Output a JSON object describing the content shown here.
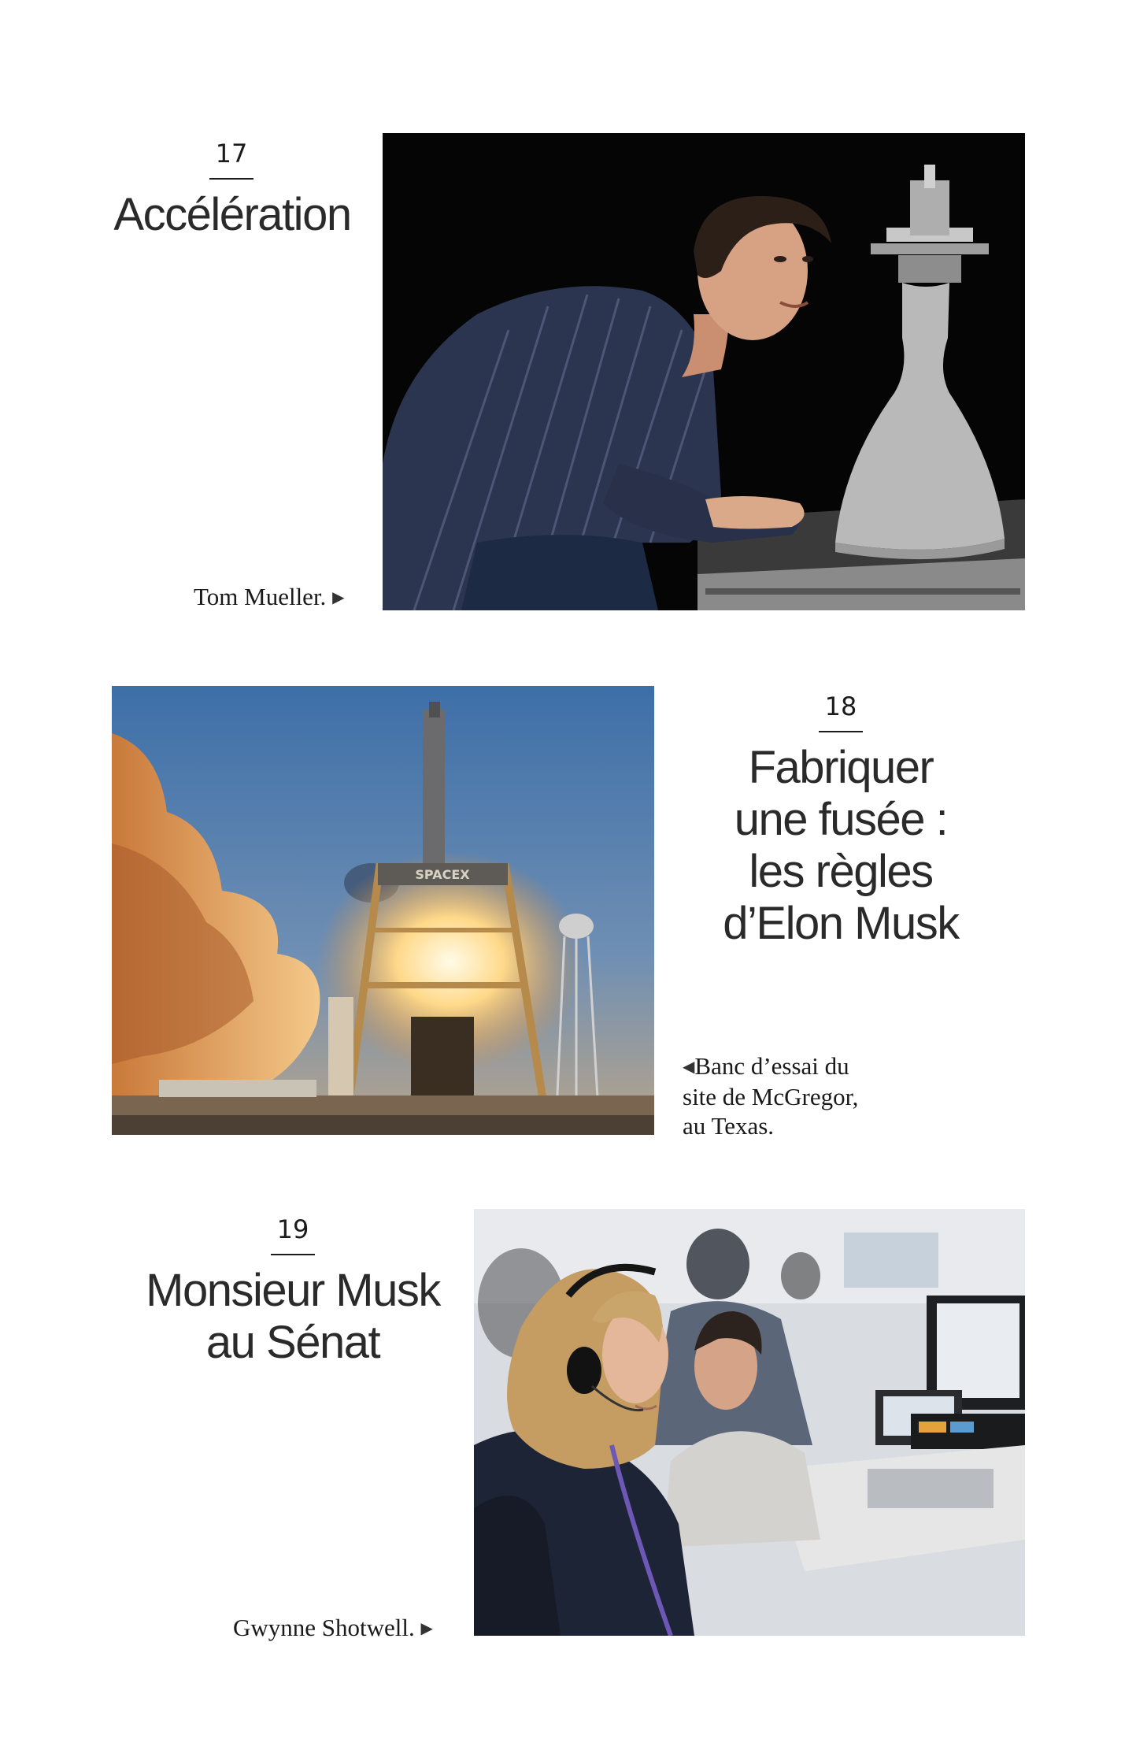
{
  "sections": [
    {
      "number": "17",
      "title_lines": [
        "Accélération"
      ],
      "caption_lines": [
        "Tom Mueller."
      ],
      "photo": "portrait of engineer beside rocket engine nozzle"
    },
    {
      "number": "18",
      "title_lines": [
        "Fabriquer",
        "une fusée :",
        "les règles",
        "d’Elon Musk"
      ],
      "caption_lines": [
        "Banc d’essai du",
        "site de McGregor,",
        "au Texas."
      ],
      "photo": "rocket test stand firing at sunset",
      "stand_label": "SPACEX"
    },
    {
      "number": "19",
      "title_lines": [
        "Monsieur Musk",
        "au Sénat"
      ],
      "caption_lines": [
        "Gwynne Shotwell."
      ],
      "photo": "woman with headset in mission control room"
    }
  ],
  "icons": {
    "caption_arrow_right": "▶",
    "caption_arrow_left": "◀"
  }
}
